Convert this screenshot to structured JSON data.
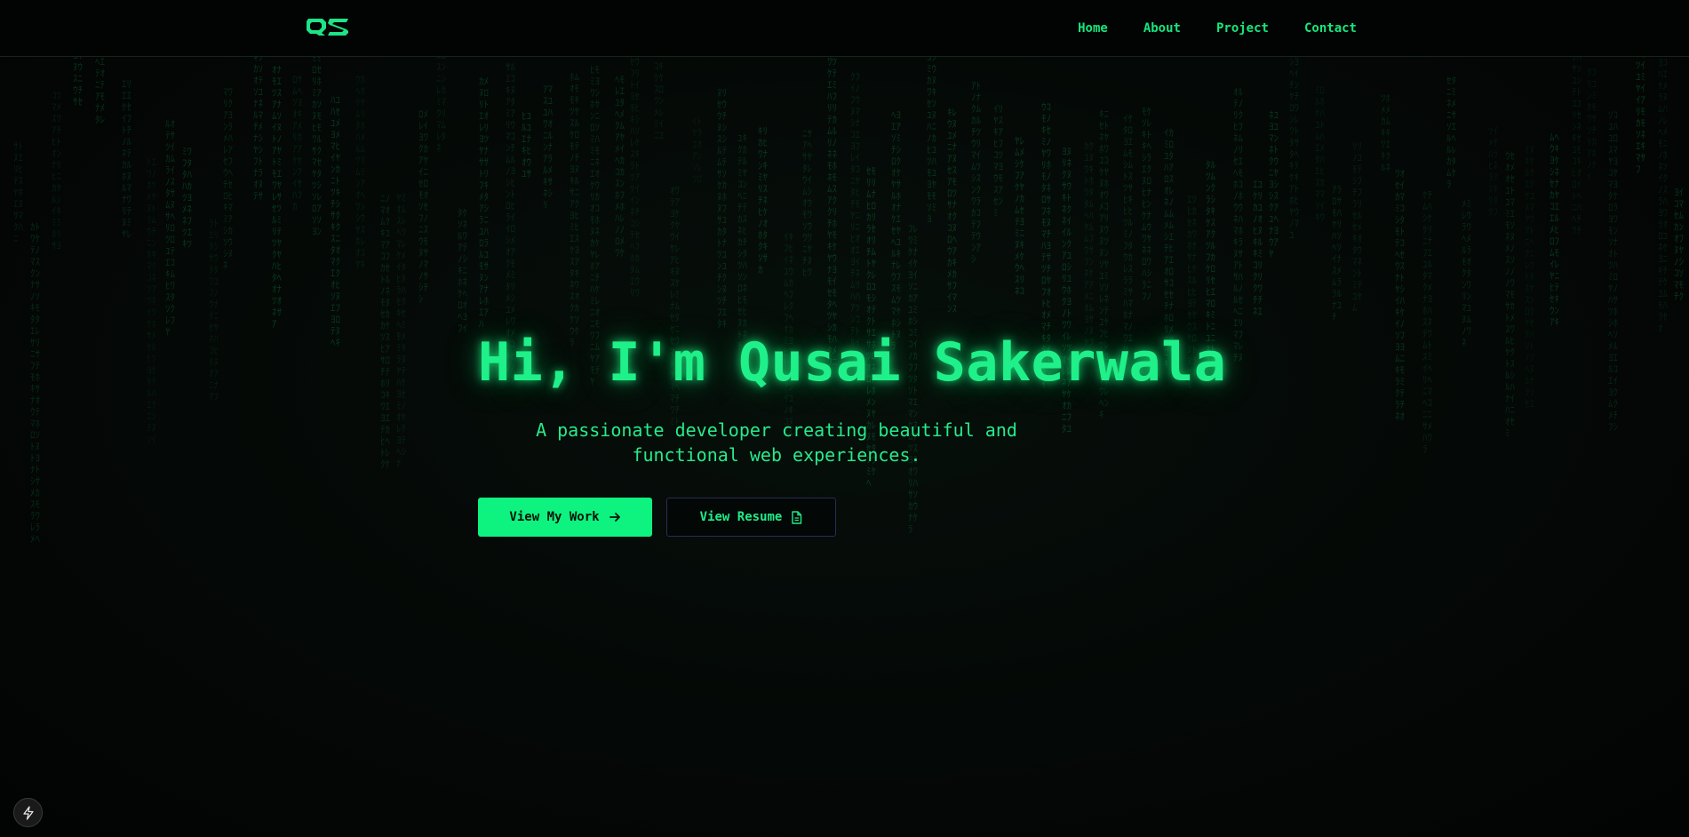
{
  "nav": {
    "logo_text": "QS",
    "links": [
      {
        "label": "Home"
      },
      {
        "label": "About"
      },
      {
        "label": "Project"
      },
      {
        "label": "Contact"
      }
    ]
  },
  "hero": {
    "title": "Hi, I'm Qusai Sakerwala",
    "subtitle": "A passionate developer creating beautiful and functional web experiences.",
    "primary_button": {
      "label": "View My Work",
      "icon": "arrow-right-icon"
    },
    "secondary_button": {
      "label": "View Resume",
      "icon": "file-text-icon"
    }
  },
  "badge": {
    "icon": "lightning-icon"
  },
  "background": {
    "effect": "matrix-rain",
    "glyphs": "ｱｲｳｴｵｶｷｸｹｺｻｼｽｾｿﾀﾁﾂﾃﾄﾅﾆﾇﾈﾉﾊﾋﾌﾍﾎﾏﾐﾑﾒﾓﾔﾕﾖﾗﾘﾙﾚﾛﾜﾝ"
  },
  "colors": {
    "accent": "#0ef27f",
    "text_green": "#17e67e",
    "background": "#030504",
    "rain": "#0c6a38",
    "secondary_border": "#2a2d55"
  }
}
